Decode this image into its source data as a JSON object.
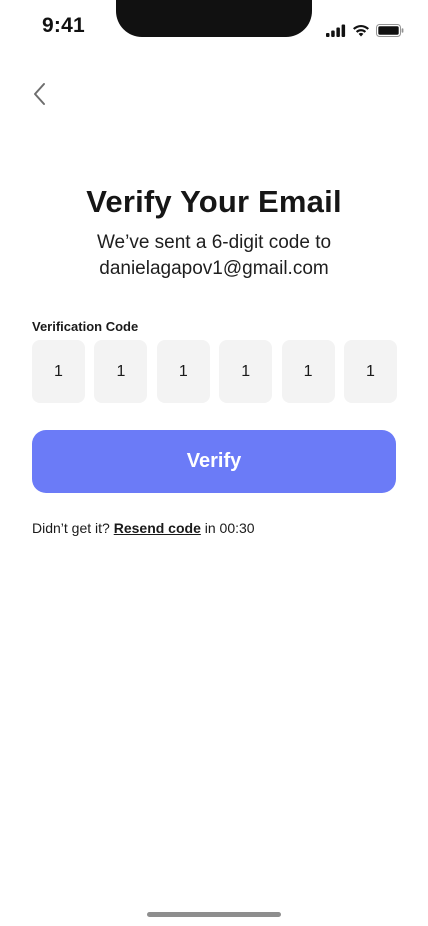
{
  "status_bar": {
    "time": "9:41"
  },
  "header": {
    "back_icon": "chevron-left-icon"
  },
  "title": "Verify Your Email",
  "subtitle": {
    "line1": "We’ve sent a 6-digit code to",
    "line2": "danielagapov1@gmail.com"
  },
  "code": {
    "label": "Verification Code",
    "digits": [
      "1",
      "1",
      "1",
      "1",
      "1",
      "1"
    ]
  },
  "verify_button": {
    "label": "Verify",
    "color": "#6b7bf7"
  },
  "resend": {
    "prefix": "Didn’t get it? ",
    "link": "Resend code",
    "middle": " in ",
    "timer": "00:30"
  }
}
